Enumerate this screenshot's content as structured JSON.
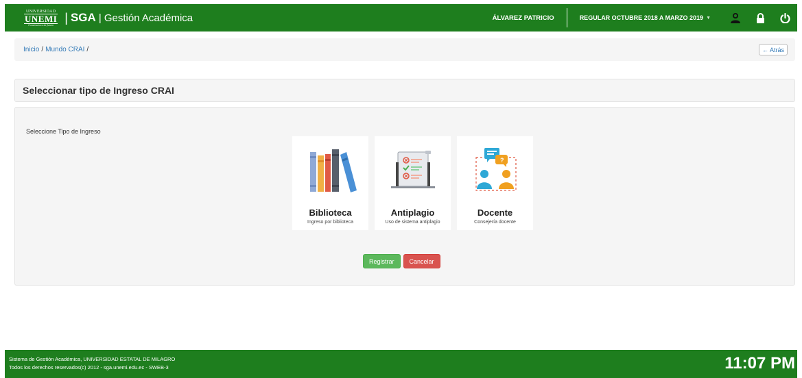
{
  "header": {
    "logo_line1": "UNIVERSIDAD",
    "logo_line2": "UNEMI",
    "logo_line3": "Constructora de futuro",
    "brand_separator": "|",
    "brand_short": "SGA",
    "brand_title": "| Gestión Académica",
    "user_name": "ÁLVAREZ PATRICIO",
    "period": "REGULAR OCTUBRE 2018 A MARZO 2019",
    "icons": [
      "user-icon",
      "lock-icon",
      "power-icon"
    ]
  },
  "breadcrumb": {
    "items": [
      "Inicio",
      "Mundo CRAI"
    ],
    "separator": "/",
    "back_label": "Atrás"
  },
  "section": {
    "title": "Seleccionar tipo de Ingreso CRAI"
  },
  "panel": {
    "label": "Seleccione Tipo de Ingreso",
    "cards": [
      {
        "title": "Biblioteca",
        "subtitle": "Ingreso por biblioteca",
        "icon": "books-icon"
      },
      {
        "title": "Antiplagio",
        "subtitle": "Uso de sistema antiplagio",
        "icon": "checklist-icon"
      },
      {
        "title": "Docente",
        "subtitle": "Consejería docente",
        "icon": "consultation-icon"
      }
    ],
    "register_label": "Registrar",
    "cancel_label": "Cancelar"
  },
  "footer": {
    "line1": "Sistema de Gestión Académica, UNIVERSIDAD ESTATAL DE MILAGRO",
    "line2": "Todos los derechos reservados(c) 2012 - sga.unemi.edu.ec - SWEB-3",
    "clock": "11:07 PM"
  },
  "colors": {
    "primary_green": "#1e7e1e",
    "success": "#5cb85c",
    "danger": "#d9534f",
    "link": "#337ab7"
  }
}
